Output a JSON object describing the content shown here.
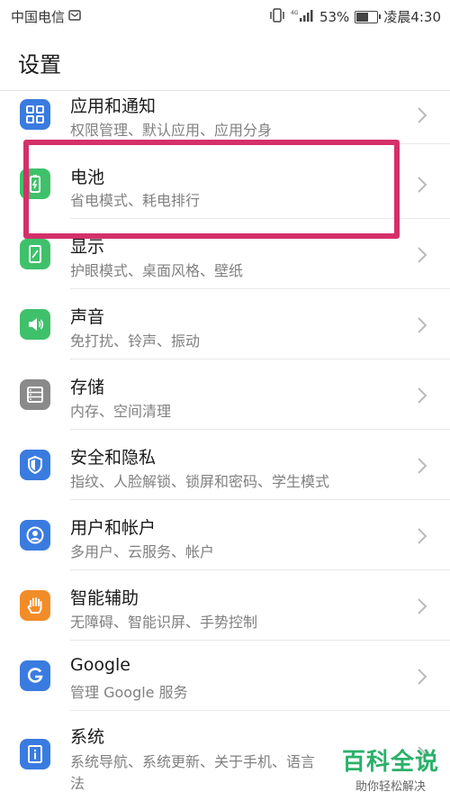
{
  "status_bar": {
    "carrier": "中国电信",
    "battery_percent": "53%",
    "battery_level": 0.53,
    "time": "凌晨4:30",
    "network": "4G"
  },
  "header": {
    "title": "设置"
  },
  "items": [
    {
      "title": "应用和通知",
      "subtitle": "权限管理、默认应用、应用分身",
      "icon": "apps-icon",
      "color": "#3a7be0"
    },
    {
      "title": "电池",
      "subtitle": "省电模式、耗电排行",
      "icon": "battery-icon",
      "color": "#3fc16b"
    },
    {
      "title": "显示",
      "subtitle": "护眼模式、桌面风格、壁纸",
      "icon": "display-icon",
      "color": "#3fc16b"
    },
    {
      "title": "声音",
      "subtitle": "免打扰、铃声、振动",
      "icon": "sound-icon",
      "color": "#3fc16b"
    },
    {
      "title": "存储",
      "subtitle": "内存、空间清理",
      "icon": "storage-icon",
      "color": "#8a8a8a"
    },
    {
      "title": "安全和隐私",
      "subtitle": "指纹、人脸解锁、锁屏和密码、学生模式",
      "icon": "security-icon",
      "color": "#3a7be0"
    },
    {
      "title": "用户和帐户",
      "subtitle": "多用户、云服务、帐户",
      "icon": "user-icon",
      "color": "#3a7be0"
    },
    {
      "title": "智能辅助",
      "subtitle": "无障碍、智能识屏、手势控制",
      "icon": "hand-icon",
      "color": "#f28c28"
    },
    {
      "title": "Google",
      "subtitle": "管理 Google 服务",
      "icon": "google-icon",
      "color": "#3a7be0"
    },
    {
      "title": "系统",
      "subtitle": "系统导航、系统更新、关于手机、语言",
      "subtitle2": "法",
      "icon": "system-icon",
      "color": "#3a7be0"
    }
  ],
  "watermark": {
    "brand": "百科全说",
    "tagline": "助你轻松解决"
  }
}
